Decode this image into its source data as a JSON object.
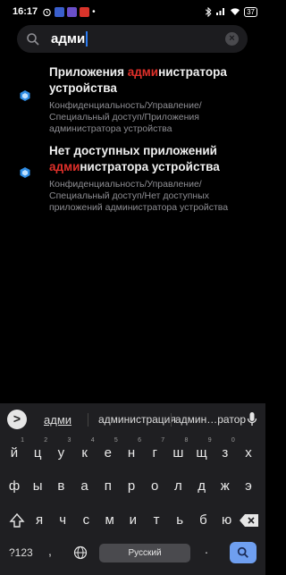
{
  "status_bar": {
    "time": "16:17",
    "battery": "37"
  },
  "search": {
    "query": "адми"
  },
  "results": [
    {
      "title_highlight": "адми",
      "title_line1_pre": "Приложения ",
      "title_line1_post": "нистратора",
      "title_line2": "устройства",
      "path": "Конфиденциальность/Управление/Специальный доступ/Приложения администратора устройства"
    },
    {
      "title_line1": "Нет доступных приложений",
      "title_highlight": "адми",
      "title_line2_post": "нистратора устройства",
      "path": "Конфиденциальность/Управление/Специальный доступ/Нет доступных приложений администратора устройства"
    }
  ],
  "keyboard": {
    "suggestions": [
      "адми",
      "администрация",
      "админ…ратор"
    ],
    "expand_label": ">",
    "row1": [
      "й",
      "ц",
      "у",
      "к",
      "е",
      "н",
      "г",
      "ш",
      "щ",
      "з",
      "х"
    ],
    "row1_nums": [
      "1",
      "2",
      "3",
      "4",
      "5",
      "6",
      "7",
      "8",
      "9",
      "0",
      ""
    ],
    "row2": [
      "ф",
      "ы",
      "в",
      "а",
      "п",
      "р",
      "о",
      "л",
      "д",
      "ж",
      "э"
    ],
    "row3": [
      "я",
      "ч",
      "с",
      "м",
      "и",
      "т",
      "ь",
      "б",
      "ю"
    ],
    "sym_label": "?123",
    "emoji_label": ",",
    "space_label": "Русский",
    "dot_label": "."
  }
}
